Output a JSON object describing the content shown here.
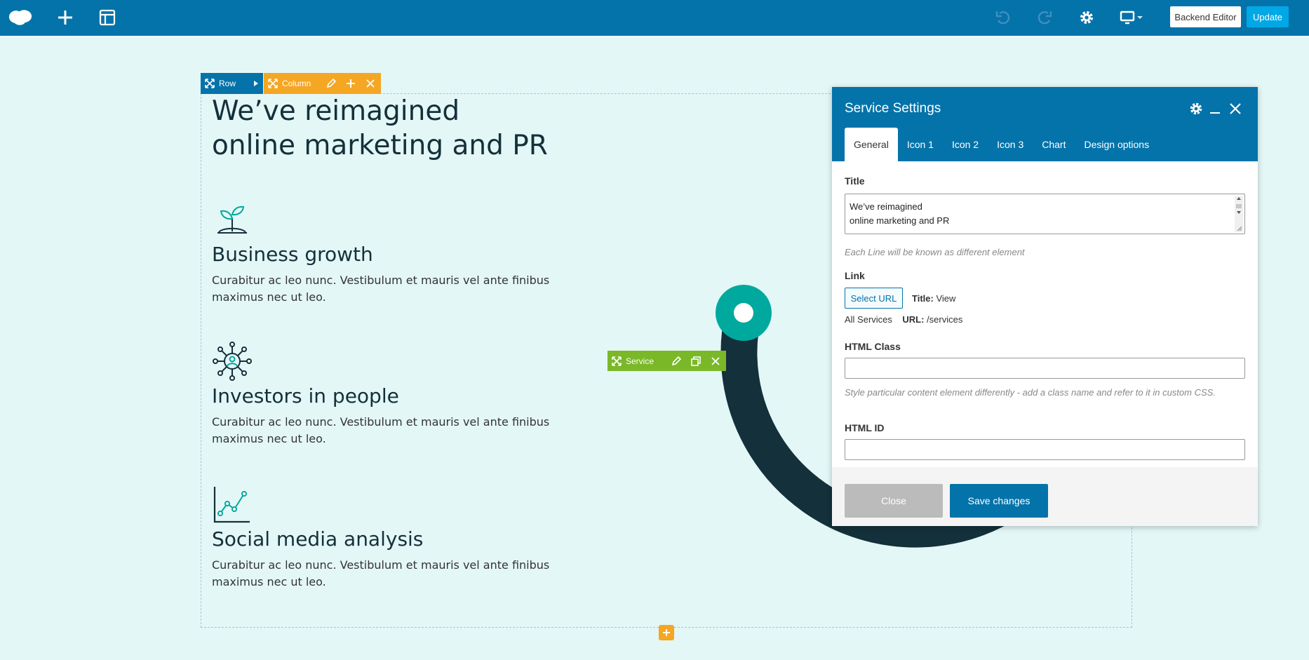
{
  "topbar": {
    "icons": [
      "logo-icon",
      "plus-icon",
      "layout-icon",
      "undo-icon",
      "redo-icon",
      "gear-icon",
      "monitor-icon"
    ],
    "backend_editor_label": "Backend Editor",
    "update_label": "Update",
    "colors": {
      "bar": "#0473aa",
      "update": "#00a8e6"
    }
  },
  "controls": {
    "row_label": "Row",
    "column_label": "Column",
    "service_label": "Service"
  },
  "content": {
    "headline_line1": "We’ve reimagined",
    "headline_line2": "online marketing and PR",
    "services": [
      {
        "icon": "sprout-icon",
        "title": "Business growth",
        "text": "Curabitur ac leo nunc. Vestibulum et mauris vel ante finibus maximus nec ut leo."
      },
      {
        "icon": "network-icon",
        "title": "Investors in people",
        "text": "Curabitur ac leo nunc. Vestibulum et mauris vel ante finibus maximus nec ut leo."
      },
      {
        "icon": "line-chart-icon",
        "title": "Social media analysis",
        "text": "Curabitur ac leo nunc. Vestibulum et mauris vel ante finibus maximus nec ut leo."
      }
    ],
    "colors": {
      "heading": "#14303a",
      "accent": "#00a99d",
      "ring": "#14303a"
    }
  },
  "modal": {
    "title": "Service Settings",
    "tabs": [
      "General",
      "Icon 1",
      "Icon 2",
      "Icon 3",
      "Chart",
      "Design options"
    ],
    "active_tab": "General",
    "title_label": "Title",
    "title_value_line1": "We’ve reimagined",
    "title_value_line2": "online marketing and PR",
    "title_hint": "Each Line will be known as different element",
    "link_label": "Link",
    "select_url_label": "Select URL",
    "link_title_key": "Title:",
    "link_title_value": "View",
    "link_title_cont": "All Services",
    "link_url_key": "URL:",
    "link_url_value": "/services",
    "html_class_label": "HTML Class",
    "html_class_hint": "Style particular content element differently - add a class name and refer to it in custom CSS.",
    "html_id_label": "HTML ID",
    "close_label": "Close",
    "save_label": "Save changes"
  }
}
